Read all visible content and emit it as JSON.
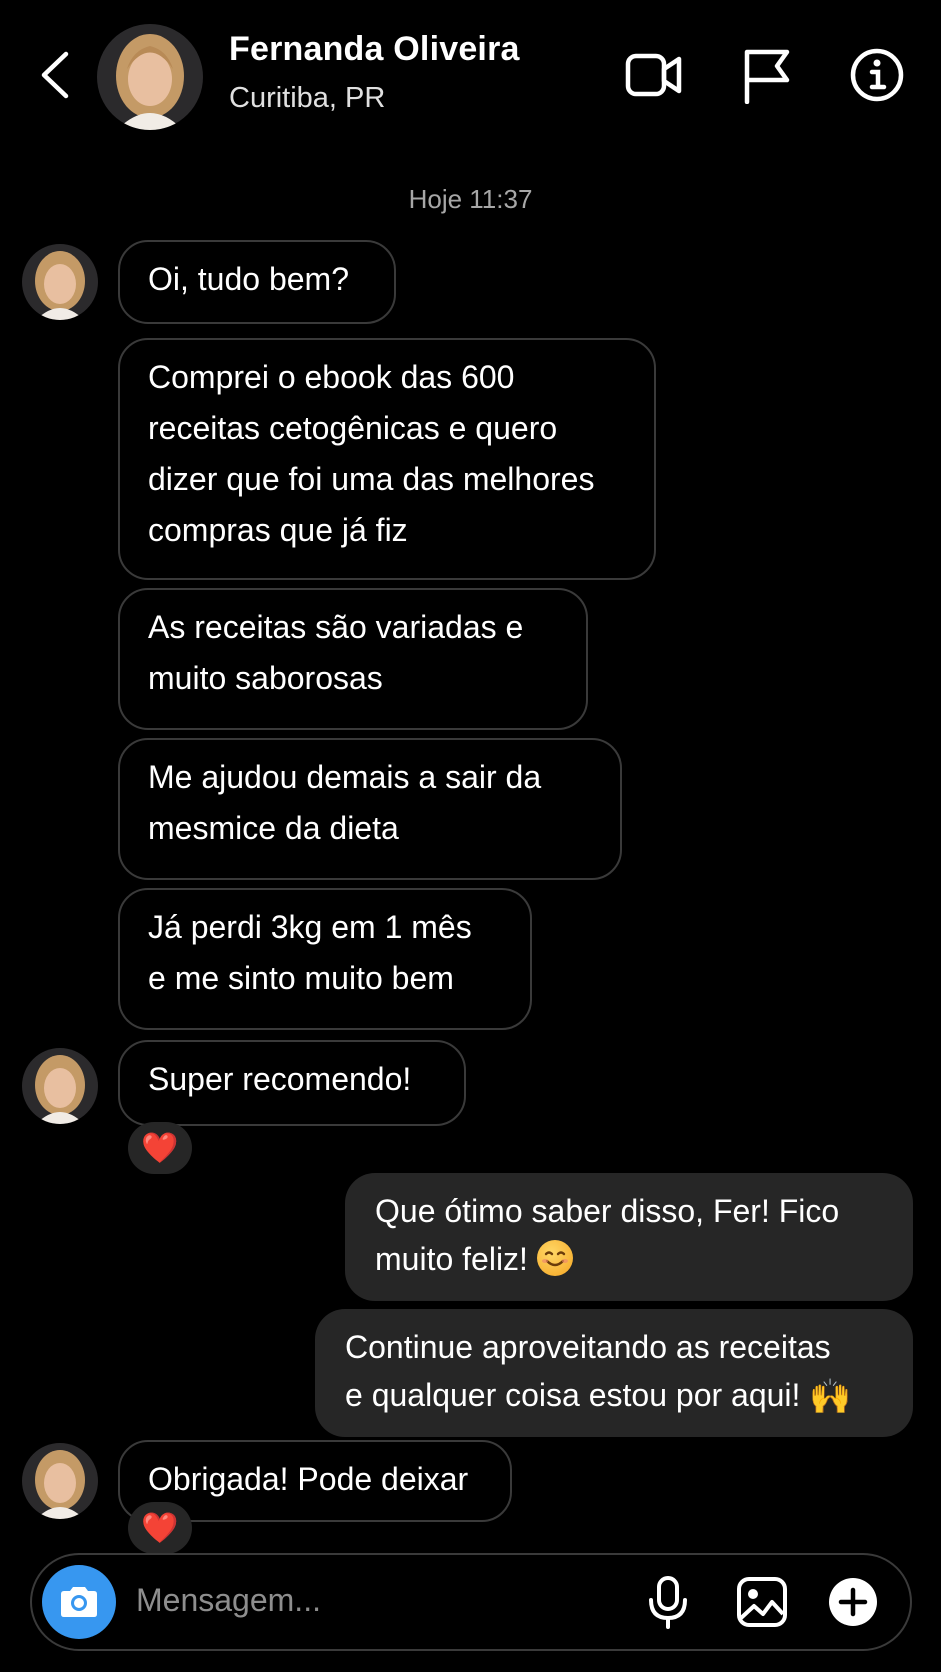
{
  "header": {
    "name": "Fernanda Oliveira",
    "location": "Curitiba, PR",
    "icons": [
      "back-chevron-icon",
      "video-call-icon",
      "flag-icon",
      "info-icon"
    ]
  },
  "timestamp": "Hoje 11:37",
  "messages": [
    {
      "lines": [
        "Oi, tudo bem?"
      ]
    },
    {
      "lines": [
        "Comprei o ebook das 600",
        "receitas cetogênicas e quero",
        "dizer que foi uma das melhores",
        "compras que já fiz"
      ]
    },
    {
      "lines": [
        "As receitas são variadas e",
        "muito saborosas"
      ]
    },
    {
      "lines": [
        "Me ajudou demais a sair da",
        "mesmice da dieta"
      ]
    },
    {
      "lines": [
        "Já perdi 3kg em 1 mês",
        "e me sinto muito bem"
      ]
    },
    {
      "lines": [
        "Super recomendo!"
      ],
      "reaction": "❤️"
    },
    {
      "lines": [
        "Que ótimo saber disso, Fer! Fico",
        "muito feliz!"
      ],
      "emoji": "smiling-face"
    },
    {
      "lines": [
        "Continue aproveitando as receitas",
        "e qualquer coisa estou por aqui!"
      ],
      "emoji": "🙌"
    },
    {
      "lines": [
        "Obrigada! Pode deixar"
      ],
      "reaction": "❤️"
    }
  ],
  "composer": {
    "placeholder": "Mensagem...",
    "icons": [
      "camera-icon",
      "microphone-icon",
      "gallery-icon",
      "plus-icon"
    ]
  },
  "colors": {
    "background": "#000000",
    "outgoing_bubble": "#262626",
    "incoming_border": "#3a3a3a",
    "camera_button": "#3797f0"
  }
}
